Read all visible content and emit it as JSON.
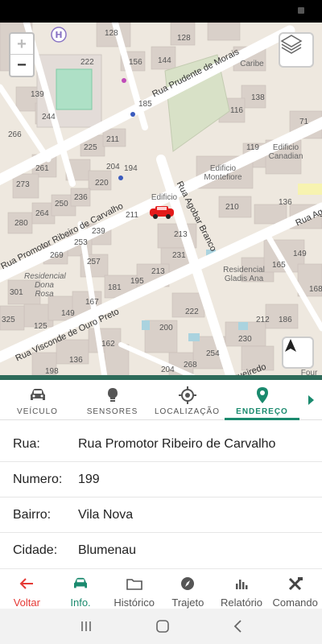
{
  "map": {
    "streets": [
      {
        "name": "Rua Prudente de Morais"
      },
      {
        "name": "Rua Promotor Ribeiro de Carvalho"
      },
      {
        "name": "Rua Agobar Branco"
      },
      {
        "name": "Rua Visconde de Ouro Preto"
      },
      {
        "name": "Rua Agoba"
      },
      {
        "name": "queiredo"
      }
    ],
    "places": [
      {
        "name": "Edificio Canadian"
      },
      {
        "name": "Edificio Montefiore"
      },
      {
        "name": "Edificio"
      },
      {
        "name": "Residencial Dona Rosa"
      },
      {
        "name": "Residencial Gladis Ana"
      },
      {
        "name": "Caribe"
      },
      {
        "name": "Four Season"
      }
    ],
    "numbers": [
      "128",
      "128",
      "156",
      "144",
      "222",
      "185",
      "116",
      "138",
      "139",
      "71",
      "244",
      "266",
      "225",
      "211",
      "119",
      "261",
      "204",
      "194",
      "273",
      "220",
      "236",
      "250",
      "264",
      "280",
      "239",
      "211",
      "210",
      "136",
      "253",
      "269",
      "213",
      "165",
      "149",
      "257",
      "231",
      "168",
      "195",
      "213",
      "181",
      "301",
      "167",
      "149",
      "125",
      "325",
      "222",
      "212",
      "186",
      "200",
      "162",
      "230",
      "268",
      "136",
      "254",
      "198",
      "204"
    ]
  },
  "controls": {
    "zoom_in": "+",
    "zoom_out": "−",
    "layers_icon": "layers-icon",
    "locate_icon": "navigation-arrow-icon"
  },
  "tabs": [
    {
      "label": "VEÍCULO",
      "icon": "car-icon",
      "active": false
    },
    {
      "label": "SENSORES",
      "icon": "lightbulb-icon",
      "active": false
    },
    {
      "label": "LOCALIZAÇÃO",
      "icon": "crosshair-icon",
      "active": false
    },
    {
      "label": "ENDEREÇO",
      "icon": "map-pin-icon",
      "active": true
    }
  ],
  "address": {
    "street_label": "Rua:",
    "street_value": "Rua Promotor Ribeiro de Carvalho",
    "number_label": "Numero:",
    "number_value": "199",
    "district_label": "Bairro:",
    "district_value": "Vila Nova",
    "city_label": "Cidade:",
    "city_value": "Blumenau"
  },
  "bottom_nav": [
    {
      "label": "Voltar",
      "icon": "arrow-left-icon"
    },
    {
      "label": "Info.",
      "icon": "car-icon"
    },
    {
      "label": "Histórico",
      "icon": "folder-icon"
    },
    {
      "label": "Trajeto",
      "icon": "compass-icon"
    },
    {
      "label": "Relatório",
      "icon": "bar-chart-icon"
    },
    {
      "label": "Comando",
      "icon": "tools-icon"
    }
  ],
  "colors": {
    "accent": "#1a8a6e",
    "back": "#e53935",
    "map_bg": "#eee8df",
    "building": "#d9d0c9",
    "park": "#cfe8d2"
  }
}
